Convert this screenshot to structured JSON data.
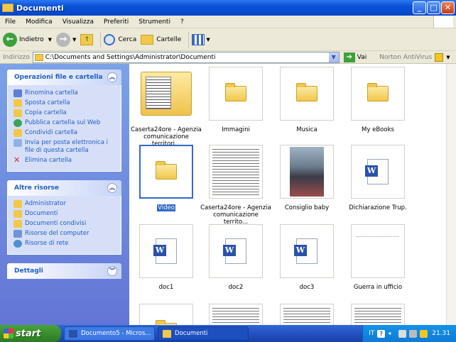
{
  "window": {
    "title": "Documenti"
  },
  "menu": [
    "File",
    "Modifica",
    "Visualizza",
    "Preferiti",
    "Strumenti",
    "?"
  ],
  "toolbar": {
    "back": "Indietro",
    "search": "Cerca",
    "folders": "Cartelle"
  },
  "address": {
    "label": "Indirizzo",
    "path": "C:\\Documents and Settings\\Administrator\\Documenti",
    "go": "Vai",
    "norton": "Norton AntiVirus"
  },
  "taskpane": {
    "file_tasks": {
      "title": "Operazioni file e cartella",
      "items": [
        "Rinomina cartella",
        "Sposta cartella",
        "Copia cartella",
        "Pubblica cartella sul Web",
        "Condividi cartella",
        "Invia per posta elettronica i file di questa cartella",
        "Elimina cartella"
      ]
    },
    "other_places": {
      "title": "Altre risorse",
      "items": [
        "Administrator",
        "Documenti",
        "Documenti condivisi",
        "Risorse del computer",
        "Risorse di rete"
      ]
    },
    "details": {
      "title": "Dettagli"
    }
  },
  "files": [
    {
      "name": "Caserta24ore - Agenzia comunicazione territori...",
      "kind": "folder-thumb"
    },
    {
      "name": "Immagini",
      "kind": "folder-pictures"
    },
    {
      "name": "Musica",
      "kind": "folder-music"
    },
    {
      "name": "My eBooks",
      "kind": "folder"
    },
    {
      "name": "Video",
      "kind": "folder-video",
      "selected": true
    },
    {
      "name": "Caserta24ore - Agenzia comunicazione territo...",
      "kind": "document-thumb"
    },
    {
      "name": "Consiglio baby",
      "kind": "photo"
    },
    {
      "name": "Dichiarazione Trup.",
      "kind": "word"
    },
    {
      "name": "doc1",
      "kind": "word"
    },
    {
      "name": "doc2",
      "kind": "word"
    },
    {
      "name": "doc3",
      "kind": "word"
    },
    {
      "name": "Guerra in ufficio",
      "kind": "blank"
    }
  ],
  "taskbar": {
    "start": "start",
    "buttons": [
      "Documento5 - Micros...",
      "Documenti"
    ],
    "lang": "IT",
    "clock": "21.31"
  },
  "colors": {
    "title_blue": "#0a52d8",
    "taskpane_blue": "#6375d6",
    "selection": "#316ac5",
    "start_green": "#3a8e2e"
  }
}
